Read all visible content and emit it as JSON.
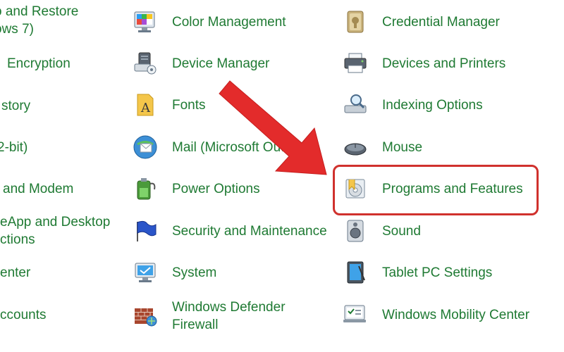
{
  "left_column": [
    {
      "line1": "o and Restore",
      "line2": "ows 7)"
    },
    {
      "line1": "Encryption"
    },
    {
      "line1": "story"
    },
    {
      "line1": "2-bit)"
    },
    {
      "line1": "and Modem"
    },
    {
      "line1": "eApp and Desktop",
      "line2": "ctions"
    },
    {
      "line1": "enter"
    },
    {
      "line1": "ccounts"
    }
  ],
  "middle_column": [
    {
      "label": "Color Management",
      "icon": "color-management-icon"
    },
    {
      "label": "Device Manager",
      "icon": "device-manager-icon"
    },
    {
      "label": "Fonts",
      "icon": "fonts-icon"
    },
    {
      "label": "Mail (Microsoft Outlook)",
      "icon": "mail-icon"
    },
    {
      "label": "Power Options",
      "icon": "power-options-icon"
    },
    {
      "label": "Security and Maintenance",
      "icon": "security-flag-icon"
    },
    {
      "label": "System",
      "icon": "system-icon"
    },
    {
      "label": "Windows Defender",
      "label2": "Firewall",
      "icon": "firewall-icon"
    }
  ],
  "right_column": [
    {
      "label": "Credential Manager",
      "icon": "credential-manager-icon"
    },
    {
      "label": "Devices and Printers",
      "icon": "devices-printers-icon"
    },
    {
      "label": "Indexing Options",
      "icon": "indexing-options-icon"
    },
    {
      "label": "Mouse",
      "icon": "mouse-icon"
    },
    {
      "label": "Programs and Features",
      "icon": "programs-features-icon"
    },
    {
      "label": "Sound",
      "icon": "sound-icon"
    },
    {
      "label": "Tablet PC Settings",
      "icon": "tablet-pc-icon"
    },
    {
      "label": "Windows Mobility Center",
      "icon": "mobility-center-icon"
    }
  ],
  "colors": {
    "link_green": "#1f7a33",
    "highlight_red": "#d0312d",
    "arrow_red": "#e32b2b"
  }
}
